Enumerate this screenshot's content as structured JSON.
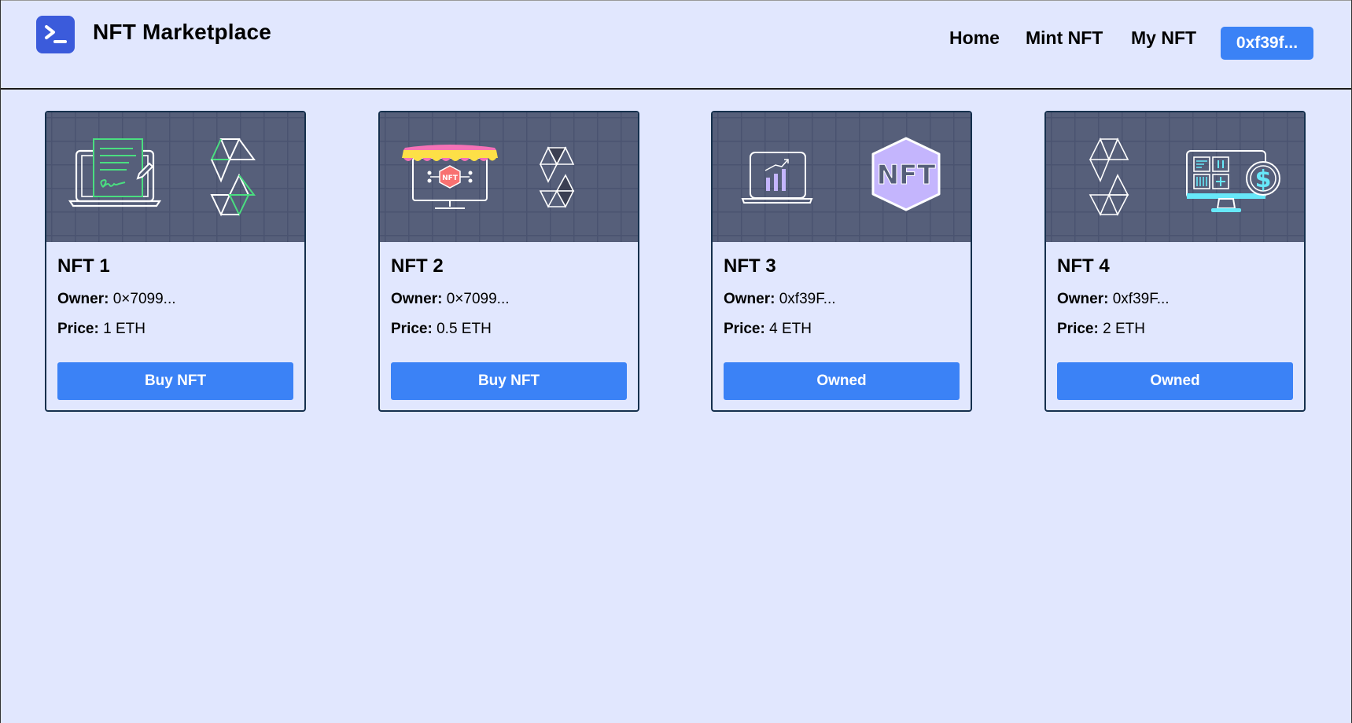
{
  "header": {
    "brand": "NFT Marketplace",
    "logo_icon": "terminal-prompt-icon",
    "nav": {
      "home": "Home",
      "mint": "Mint NFT",
      "my": "My NFT"
    },
    "wallet": "0xf39f..."
  },
  "labels": {
    "owner": "Owner:",
    "price": "Price:"
  },
  "colors": {
    "accent": "#3b82f6",
    "logo": "#3b5bdb",
    "background": "#e1e7fe",
    "card_image_bg": "#565f7a"
  },
  "cards": [
    {
      "title": "NFT 1",
      "owner": "0×7099...",
      "price": "1 ETH",
      "button": "Buy NFT",
      "icons": [
        "signed-document-laptop-icon",
        "ethereum-triangles-icon"
      ]
    },
    {
      "title": "NFT 2",
      "owner": "0×7099...",
      "price": "0.5 ETH",
      "button": "Buy NFT",
      "icons": [
        "nft-storefront-monitor-icon",
        "ethereum-triangles-icon"
      ]
    },
    {
      "title": "NFT 3",
      "owner": "0xf39F...",
      "price": "4 ETH",
      "button": "Owned",
      "icons": [
        "laptop-chart-icon",
        "nft-hexagon-icon"
      ],
      "badge_text": "NFT"
    },
    {
      "title": "NFT 4",
      "owner": "0xf39F...",
      "price": "2 ETH",
      "button": "Owned",
      "icons": [
        "ethereum-triangles-icon",
        "dashboard-monitor-dollar-icon"
      ]
    }
  ]
}
